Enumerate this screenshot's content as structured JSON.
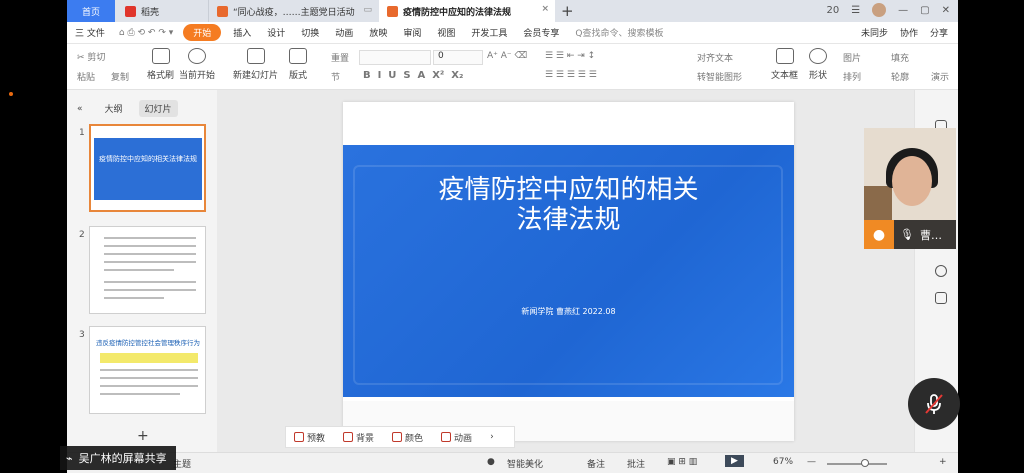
{
  "tabs": {
    "home": "首页",
    "daoke": "稻壳",
    "doc1": "“同心战疫，……主题党日活动",
    "doc2": "疫情防控中应知的法律法规",
    "add": "+"
  },
  "window": {
    "badge": "20",
    "menu": "☰"
  },
  "menu": {
    "file": "三 文件",
    "items": [
      "开始",
      "插入",
      "设计",
      "切换",
      "动画",
      "放映",
      "审阅",
      "视图",
      "开发工具",
      "会员专享"
    ],
    "active": "开始",
    "search": "Q查找命令、搜索模板",
    "sync": "未同步",
    "collab": "协作",
    "share": "分享"
  },
  "ribbon": {
    "cut": "剪切",
    "copy": "复制",
    "paste": "粘贴",
    "format": "格式刷",
    "play": "当前开始",
    "new_slide": "新建幻灯片",
    "layout": "版式",
    "section": "节",
    "reset": "重置",
    "font_size": "0",
    "align": "对齐文本",
    "smartart": "转智能图形",
    "textbox": "文本框",
    "shape": "形状",
    "image": "图片",
    "sort": "排列",
    "fill": "填充",
    "outline": "轮廓",
    "text_style": "演示"
  },
  "left_panel": {
    "outline_tab": "大纲",
    "slides_tab": "幻灯片",
    "slide_numbers": [
      "1",
      "2",
      "3"
    ],
    "thumb1_title": "疫情防控中应知的相关法律法规",
    "thumb3_title": "违反疫情防控管控社会管理秩序行为",
    "add": "+"
  },
  "slide": {
    "title_line1": "疫情防控中应知的相关",
    "title_line2": "法律法规",
    "subtitle": "新闻学院  曹燕红        2022.08"
  },
  "float_toolbar": {
    "preview": "预教",
    "background": "背景",
    "color": "颜色",
    "animation": "动画"
  },
  "status": {
    "theme": "主题",
    "beautify": "智能美化",
    "notes": "备注",
    "comments": "批注",
    "zoom": "67%"
  },
  "webcam": {
    "name": "曹…"
  },
  "share_label": "吴广林的屏幕共享"
}
